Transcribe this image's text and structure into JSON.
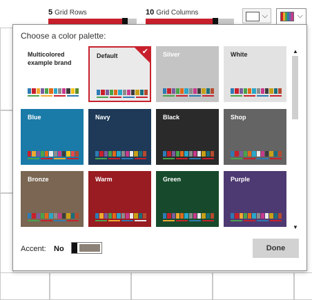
{
  "toolbar": {
    "grid_rows": {
      "value": "5",
      "label": "Grid Rows",
      "fraction": 0.87
    },
    "grid_columns": {
      "value": "10",
      "label": "Grid Columns",
      "fraction": 0.79
    }
  },
  "popup": {
    "title": "Choose a color palette:",
    "palettes": [
      {
        "name": "Multicolored example brand",
        "bg": "#ffffff",
        "fg": "#222222",
        "swatches": [
          "#2e7bb4",
          "#c8202c",
          "#f0a830",
          "#7a5c9e",
          "#4aa34a",
          "#e06a1a",
          "#2aa7c8",
          "#8c8c8c",
          "#c83a8c",
          "#3c3c3c",
          "#f4c418",
          "#5a8c2e"
        ],
        "lines": [
          "#4aa34a",
          "#f0a830",
          "#c8202c",
          "#2e7bb4"
        ]
      },
      {
        "name": "Default",
        "bg": "#eaeaea",
        "fg": "#222222",
        "selected": true,
        "swatches": [
          "#2e7bb4",
          "#c8202c",
          "#7a5c9e",
          "#4aa34a",
          "#e06a1a",
          "#2aa7c8",
          "#8c8c8c",
          "#c83a8c",
          "#3c3c3c",
          "#c8a018",
          "#1a6e7a",
          "#b44a2e"
        ],
        "lines": [
          "#4aa34a",
          "#c8202c",
          "#2e7bb4",
          "#c8202c"
        ]
      },
      {
        "name": "Silver",
        "bg": "#c4c4c4",
        "fg": "#ffffff",
        "swatches": [
          "#2e7bb4",
          "#c8202c",
          "#7a5c9e",
          "#4aa34a",
          "#e06a1a",
          "#2aa7c8",
          "#8c8c8c",
          "#c83a8c",
          "#3c3c3c",
          "#c8a018",
          "#1a6e7a",
          "#b44a2e"
        ],
        "lines": [
          "#4aa34a",
          "#c8202c",
          "#2e7bb4",
          "#c8202c"
        ]
      },
      {
        "name": "White",
        "bg": "#e2e2e2",
        "fg": "#222222",
        "swatches": [
          "#2e7bb4",
          "#c8202c",
          "#7a5c9e",
          "#4aa34a",
          "#e06a1a",
          "#2aa7c8",
          "#8c8c8c",
          "#c83a8c",
          "#3c3c3c",
          "#c8a018",
          "#1a6e7a",
          "#b44a2e"
        ],
        "lines": [
          "#4aa34a",
          "#c8202c",
          "#2e7bb4",
          "#c8202c"
        ]
      },
      {
        "name": "Blue",
        "bg": "#1a7ba8",
        "fg": "#ffffff",
        "swatches": [
          "#c8202c",
          "#f0a830",
          "#7a5c9e",
          "#4aa34a",
          "#e06a1a",
          "#eaeaea",
          "#8c8c8c",
          "#c83a8c",
          "#3c3c3c",
          "#f4c418",
          "#e84a4a",
          "#b44a2e"
        ],
        "lines": [
          "#4aa34a",
          "#c8202c",
          "#f0a830",
          "#c8202c"
        ]
      },
      {
        "name": "Navy",
        "bg": "#1e3a58",
        "fg": "#ffffff",
        "swatches": [
          "#2e7bb4",
          "#c8202c",
          "#7a5c9e",
          "#4aa34a",
          "#e06a1a",
          "#2aa7c8",
          "#8c8c8c",
          "#c83a8c",
          "#eaeaea",
          "#c8a018",
          "#1a6e7a",
          "#b44a2e"
        ],
        "lines": [
          "#4aa34a",
          "#c8202c",
          "#2e7bb4",
          "#c8202c"
        ]
      },
      {
        "name": "Black",
        "bg": "#2a2a2a",
        "fg": "#ffffff",
        "swatches": [
          "#2e7bb4",
          "#c8202c",
          "#7a5c9e",
          "#4aa34a",
          "#e06a1a",
          "#2aa7c8",
          "#8c8c8c",
          "#c83a8c",
          "#eaeaea",
          "#c8a018",
          "#1a6e7a",
          "#b44a2e"
        ],
        "lines": [
          "#4aa34a",
          "#c8202c",
          "#2e7bb4",
          "#c8202c"
        ]
      },
      {
        "name": "Shop",
        "bg": "#646464",
        "fg": "#ffffff",
        "swatches": [
          "#2e7bb4",
          "#c8202c",
          "#7a5c9e",
          "#4aa34a",
          "#e06a1a",
          "#2aa7c8",
          "#eaeaea",
          "#c83a8c",
          "#3c3c3c",
          "#c8a018",
          "#1a6e7a",
          "#b44a2e"
        ],
        "lines": [
          "#4aa34a",
          "#c8202c",
          "#2e7bb4",
          "#c8202c"
        ]
      },
      {
        "name": "Bronze",
        "bg": "#7a6652",
        "fg": "#ffffff",
        "swatches": [
          "#2e7bb4",
          "#c8202c",
          "#7a5c9e",
          "#4aa34a",
          "#e06a1a",
          "#2aa7c8",
          "#8c8c8c",
          "#c83a8c",
          "#3c3c3c",
          "#c8a018",
          "#1a6e7a",
          "#b44a2e"
        ],
        "lines": [
          "#4aa34a",
          "#c8202c",
          "#2e7bb4",
          "#c8202c"
        ]
      },
      {
        "name": "Warm",
        "bg": "#981c22",
        "fg": "#ffffff",
        "swatches": [
          "#2e7bb4",
          "#f0a830",
          "#7a5c9e",
          "#4aa34a",
          "#e06a1a",
          "#2aa7c8",
          "#8c8c8c",
          "#c83a8c",
          "#eaeaea",
          "#c8a018",
          "#1a6e7a",
          "#b44a2e"
        ],
        "lines": [
          "#4aa34a",
          "#f0a830",
          "#2e7bb4",
          "#eaeaea"
        ]
      },
      {
        "name": "Green",
        "bg": "#174a2c",
        "fg": "#ffffff",
        "swatches": [
          "#2e7bb4",
          "#c8202c",
          "#7a5c9e",
          "#f0a830",
          "#e06a1a",
          "#2aa7c8",
          "#8c8c8c",
          "#c83a8c",
          "#eaeaea",
          "#c8a018",
          "#1a6e7a",
          "#b44a2e"
        ],
        "lines": [
          "#f0a830",
          "#c8202c",
          "#2e7bb4",
          "#c8202c"
        ]
      },
      {
        "name": "Purple",
        "bg": "#4e3a72",
        "fg": "#ffffff",
        "swatches": [
          "#2e7bb4",
          "#c8202c",
          "#f0a830",
          "#4aa34a",
          "#e06a1a",
          "#2aa7c8",
          "#8c8c8c",
          "#c83a8c",
          "#eaeaea",
          "#c8a018",
          "#1a6e7a",
          "#b44a2e"
        ],
        "lines": [
          "#4aa34a",
          "#c8202c",
          "#2e7bb4",
          "#c8202c"
        ]
      }
    ],
    "accent": {
      "label": "Accent:",
      "value": "No"
    },
    "done_label": "Done",
    "icons": {
      "scroll_up": "▲",
      "scroll_down": "▼",
      "check": "✔",
      "chevron": "⌵"
    }
  }
}
